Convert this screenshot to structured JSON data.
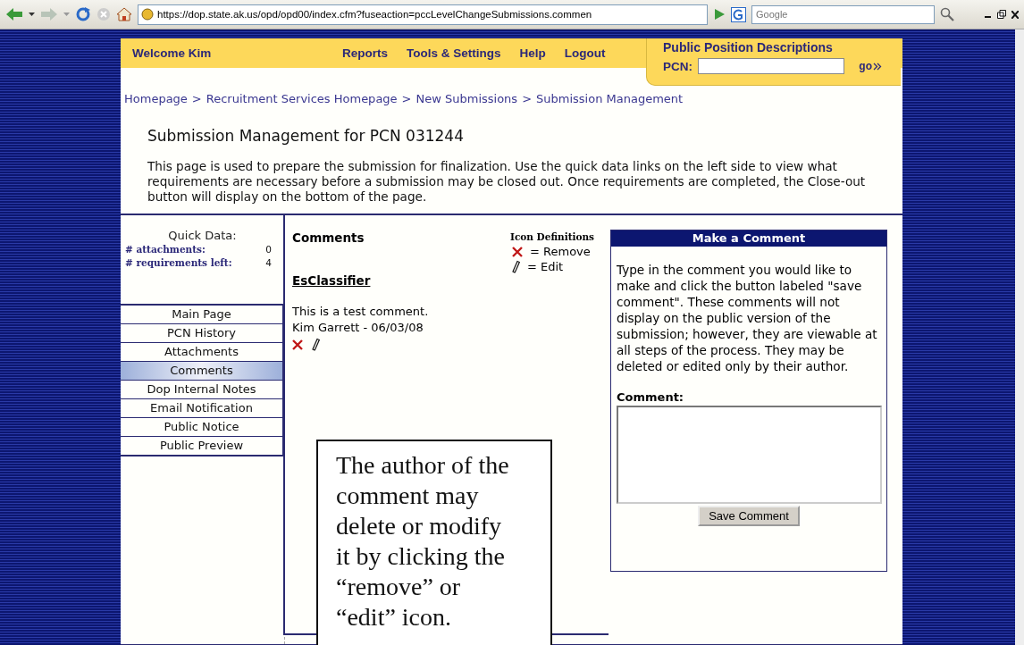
{
  "browser": {
    "url": "https://dop.state.ak.us/opd/opd00/index.cfm?fuseaction=pccLevelChangeSubmissions.commen",
    "search_placeholder": "Google"
  },
  "header": {
    "welcome": "Welcome Kim",
    "nav": [
      "Reports",
      "Tools & Settings",
      "Help",
      "Logout"
    ],
    "pcn_box": {
      "title": "Public Position Descriptions",
      "label": "PCN:",
      "go": "go"
    }
  },
  "breadcrumb": {
    "separator": ">",
    "items": [
      "Homepage",
      "Recruitment Services Homepage",
      "New Submissions",
      "Submission Management"
    ]
  },
  "title": "Submission Management for PCN 031244",
  "intro": "This page is used to prepare the submission for finalization. Use the quick data links on the left side to view what requirements are necessary before a submission may be closed out. Once requirements are completed, the Close-out button will display on the bottom of the page.",
  "quick_data": {
    "title": "Quick Data:",
    "rows": [
      {
        "label": "# attachments:",
        "value": "0"
      },
      {
        "label": "# requirements left:",
        "value": "4"
      }
    ]
  },
  "sidebar": {
    "items": [
      {
        "label": "Main Page",
        "selected": false
      },
      {
        "label": "PCN History",
        "selected": false
      },
      {
        "label": "Attachments",
        "selected": false
      },
      {
        "label": "Comments",
        "selected": true
      },
      {
        "label": "Dop Internal Notes",
        "selected": false
      },
      {
        "label": "Email Notification",
        "selected": false
      },
      {
        "label": "Public Notice",
        "selected": false
      },
      {
        "label": "Public Preview",
        "selected": false
      }
    ]
  },
  "comments": {
    "heading": "Comments",
    "icon_definitions": {
      "title": "Icon Definitions",
      "items": [
        {
          "kind": "remove",
          "label": "= Remove"
        },
        {
          "kind": "edit",
          "label": "= Edit"
        }
      ]
    },
    "section": "EsClassifier",
    "entries": [
      {
        "text": "This is a test comment.",
        "author": "Kim Garrett - 06/03/08"
      }
    ]
  },
  "make_comment": {
    "title": "Make a Comment",
    "instructions": "Type in the comment you would like to make and click the button labeled \"save comment\". These comments will not display on the public version of the submission; however, they are viewable at all steps of the process. They may be deleted or edited only by their author.",
    "field_label": "Comment:",
    "button": "Save Comment"
  },
  "callout": "The author of the comment may delete or modify it by clicking the “remove” or “edit” icon."
}
